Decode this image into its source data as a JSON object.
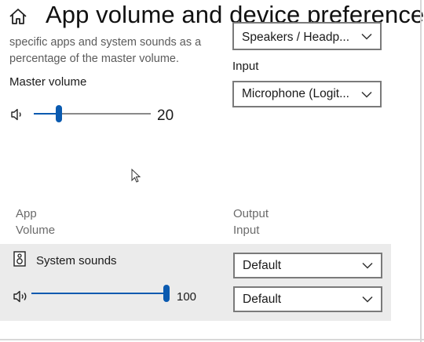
{
  "header": {
    "title": "App volume and device preferences",
    "home_icon": "home-icon"
  },
  "description": {
    "text": "specific apps and system sounds as a percentage of the master volume."
  },
  "master": {
    "label": "Master volume",
    "value": "20",
    "level": 0.2,
    "icon": "speaker-icon"
  },
  "output_device": {
    "selected": "Speakers / Headp..."
  },
  "input_device": {
    "label": "Input",
    "selected": "Microphone (Logit..."
  },
  "columns": {
    "app": "App",
    "volume": "Volume",
    "output": "Output",
    "input": "Input"
  },
  "apps": [
    {
      "name": "System sounds",
      "volume": "100",
      "level": 1.0,
      "output": "Default",
      "input": "Default"
    }
  ],
  "colors": {
    "accent": "#0a5ab0",
    "panel": "#ebebeb"
  }
}
